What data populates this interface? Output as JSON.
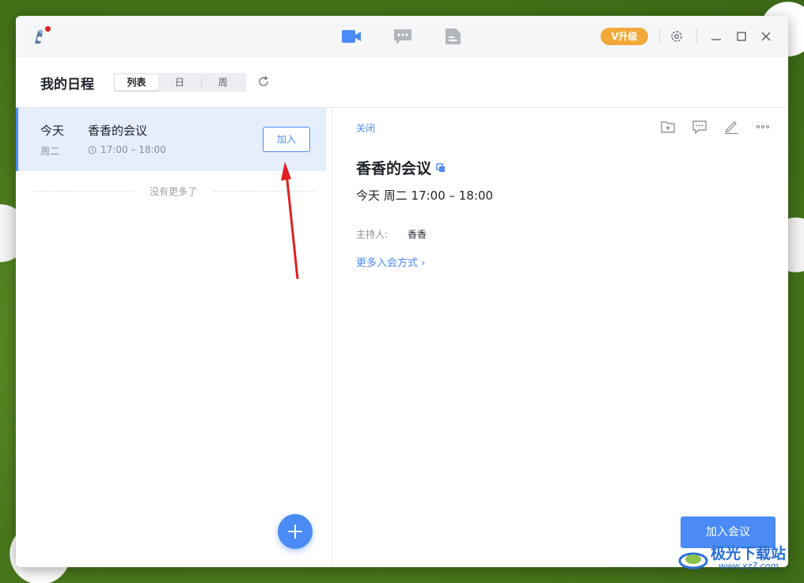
{
  "titlebar": {
    "upgrade_label": "V升级",
    "nav_icons": [
      "video-meeting-icon",
      "chat-icon",
      "document-icon"
    ],
    "window_controls": [
      "settings-icon",
      "minimize-icon",
      "maximize-icon",
      "close-icon"
    ]
  },
  "header": {
    "title": "我的日程",
    "view_tabs": [
      {
        "label": "列表",
        "active": true
      },
      {
        "label": "日",
        "active": false
      },
      {
        "label": "周",
        "active": false
      }
    ]
  },
  "list": {
    "items": [
      {
        "day": "今天",
        "weekday": "周二",
        "title": "香香的会议",
        "time": "17:00 – 18:00",
        "join_label": "加入"
      }
    ],
    "no_more": "没有更多了"
  },
  "detail": {
    "close_label": "关闭",
    "title": "香香的会议",
    "datetime": "今天 周二 17:00 – 18:00",
    "host_label": "主持人:",
    "host_value": "香香",
    "more_join_label": "更多入会方式 ›",
    "join_button_label": "加入会议",
    "tool_icons": [
      "add-folder-icon",
      "comment-icon",
      "edit-icon",
      "more-icon"
    ]
  },
  "watermark": {
    "text": "极光下载站",
    "sub": "www.xz7.com"
  },
  "colors": {
    "accent": "#4b8bf5",
    "upgrade": "#f2a93a",
    "selected_row": "#e6eefc",
    "annotation_arrow": "#e02020"
  }
}
